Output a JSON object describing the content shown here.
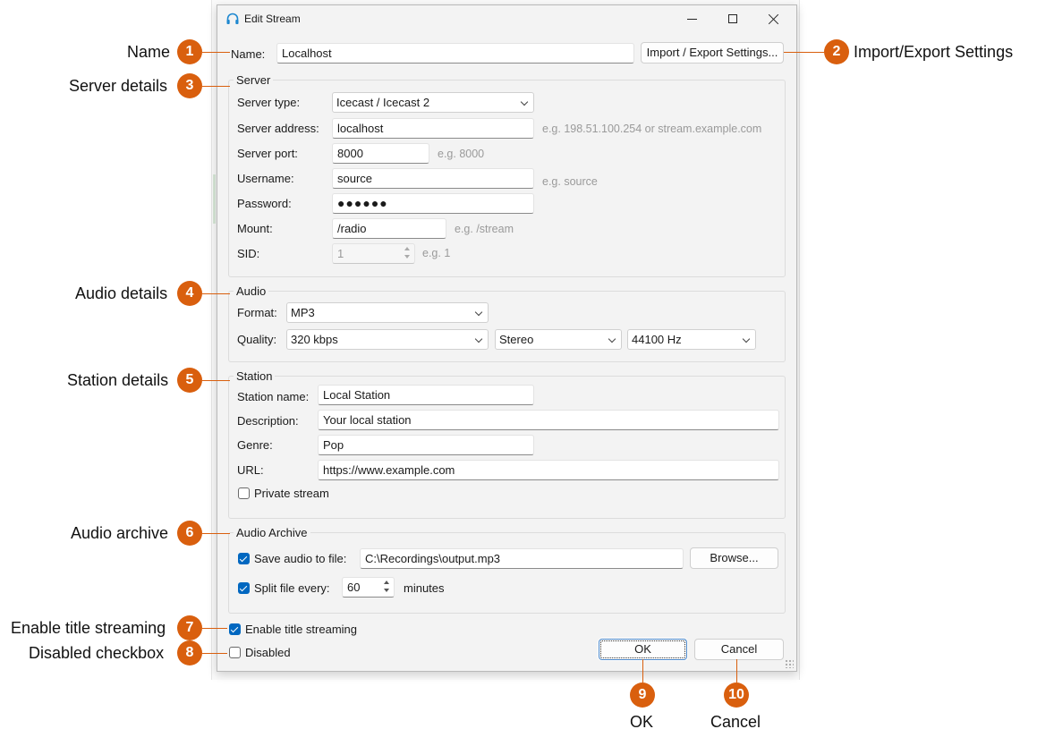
{
  "window": {
    "title": "Edit Stream"
  },
  "name_row": {
    "label": "Name:",
    "value": "Localhost",
    "import_export_button": "Import / Export Settings..."
  },
  "server": {
    "group_title": "Server",
    "type_label": "Server type:",
    "type_value": "Icecast / Icecast 2",
    "address_label": "Server address:",
    "address_value": "localhost",
    "address_hint": "e.g. 198.51.100.254 or stream.example.com",
    "port_label": "Server port:",
    "port_value": "8000",
    "port_hint": "e.g. 8000",
    "username_label": "Username:",
    "username_value": "source",
    "username_hint": "e.g. source",
    "password_label": "Password:",
    "password_value": "●●●●●●",
    "mount_label": "Mount:",
    "mount_value": "/radio",
    "mount_hint": "e.g. /stream",
    "sid_label": "SID:",
    "sid_value": "1",
    "sid_hint": "e.g. 1"
  },
  "audio": {
    "group_title": "Audio",
    "format_label": "Format:",
    "format_value": "MP3",
    "quality_label": "Quality:",
    "quality_value": "320 kbps",
    "channels_value": "Stereo",
    "samplerate_value": "44100 Hz"
  },
  "station": {
    "group_title": "Station",
    "name_label": "Station name:",
    "name_value": "Local Station",
    "description_label": "Description:",
    "description_value": "Your local station",
    "genre_label": "Genre:",
    "genre_value": "Pop",
    "url_label": "URL:",
    "url_value": "https://www.example.com",
    "private_label": "Private stream",
    "private_checked": false
  },
  "archive": {
    "group_title": "Audio Archive",
    "save_label": "Save audio to file:",
    "save_checked": true,
    "save_path": "C:\\Recordings\\output.mp3",
    "browse_button": "Browse...",
    "split_label": "Split file every:",
    "split_checked": true,
    "split_value": "60",
    "split_unit": "minutes"
  },
  "footer": {
    "title_streaming_label": "Enable title streaming",
    "title_streaming_checked": true,
    "disabled_label": "Disabled",
    "disabled_checked": false,
    "ok_button": "OK",
    "cancel_button": "Cancel"
  },
  "callouts": [
    {
      "number": "1",
      "label": "Name"
    },
    {
      "number": "2",
      "label": "Import/Export Settings"
    },
    {
      "number": "3",
      "label": "Server details"
    },
    {
      "number": "4",
      "label": "Audio details"
    },
    {
      "number": "5",
      "label": "Station details"
    },
    {
      "number": "6",
      "label": "Audio archive"
    },
    {
      "number": "7",
      "label": "Enable title streaming"
    },
    {
      "number": "8",
      "label": "Disabled checkbox"
    },
    {
      "number": "9",
      "label": "OK"
    },
    {
      "number": "10",
      "label": "Cancel"
    }
  ],
  "colors": {
    "callout": "#d95f0e",
    "checkbox_accent": "#0067c0",
    "default_button_border": "#4a86c8"
  }
}
